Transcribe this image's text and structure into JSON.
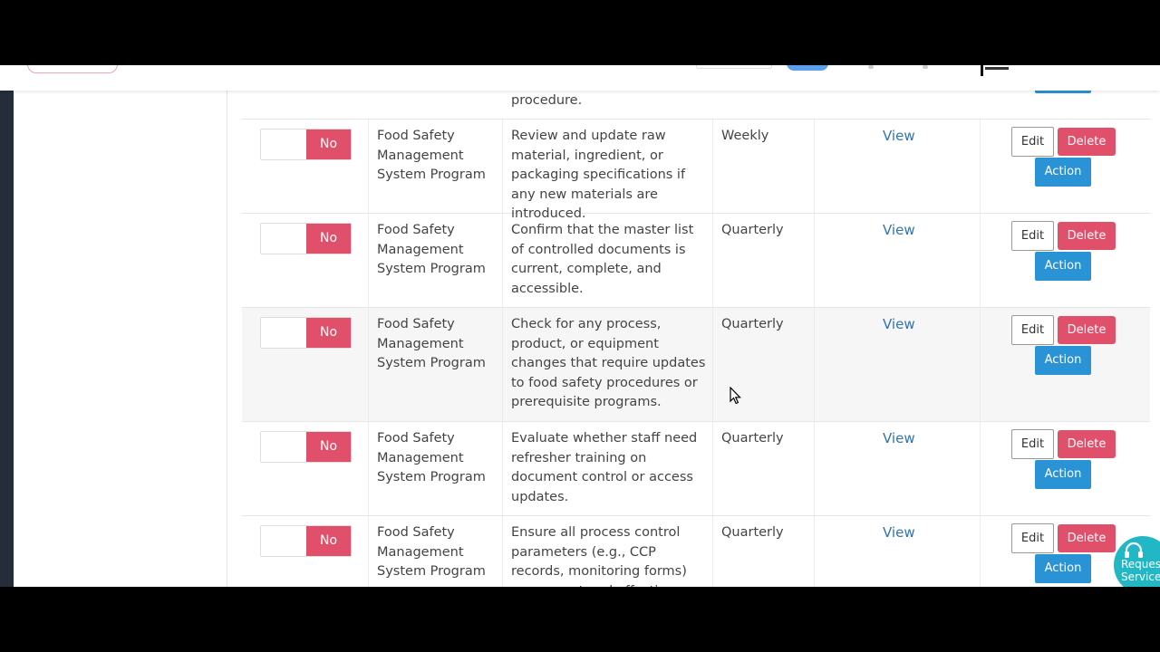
{
  "previous_row": {
    "description_tail": "procedure."
  },
  "rows": [
    {
      "toggle_label": "No",
      "program": "Food Safety Management System Program",
      "description": "Review and update raw material, ingredient, or packaging specifications if any new materials are introduced.",
      "frequency": "Weekly",
      "view_label": "View",
      "edit_label": "Edit",
      "delete_label": "Delete",
      "action_label": "Action"
    },
    {
      "toggle_label": "No",
      "program": "Food Safety Management System Program",
      "description": "Confirm that the master list of controlled documents is current, complete, and accessible.",
      "frequency": "Quarterly",
      "view_label": "View",
      "edit_label": "Edit",
      "delete_label": "Delete",
      "action_label": "Action"
    },
    {
      "toggle_label": "No",
      "program": "Food Safety Management System Program",
      "description": "Check for any process, product, or equipment changes that require updates to food safety procedures or prerequisite programs.",
      "frequency": "Quarterly",
      "view_label": "View",
      "edit_label": "Edit",
      "delete_label": "Delete",
      "action_label": "Action"
    },
    {
      "toggle_label": "No",
      "program": "Food Safety Management System Program",
      "description": "Evaluate whether staff need refresher training on document control or access updates.",
      "frequency": "Quarterly",
      "view_label": "View",
      "edit_label": "Edit",
      "delete_label": "Delete",
      "action_label": "Action"
    },
    {
      "toggle_label": "No",
      "program": "Food Safety Management System Program",
      "description": "Ensure all process control parameters (e.g., CCP records, monitoring forms) are current and effective.",
      "frequency": "Quarterly",
      "view_label": "View",
      "edit_label": "Edit",
      "delete_label": "Delete",
      "action_label": "Action"
    }
  ],
  "help_button": {
    "label": "Request Service",
    "icon": "headset-icon"
  },
  "colors": {
    "danger": "#e0506a",
    "primary": "#2a93d5",
    "link": "#2e74b5",
    "help": "#22b7c4"
  }
}
